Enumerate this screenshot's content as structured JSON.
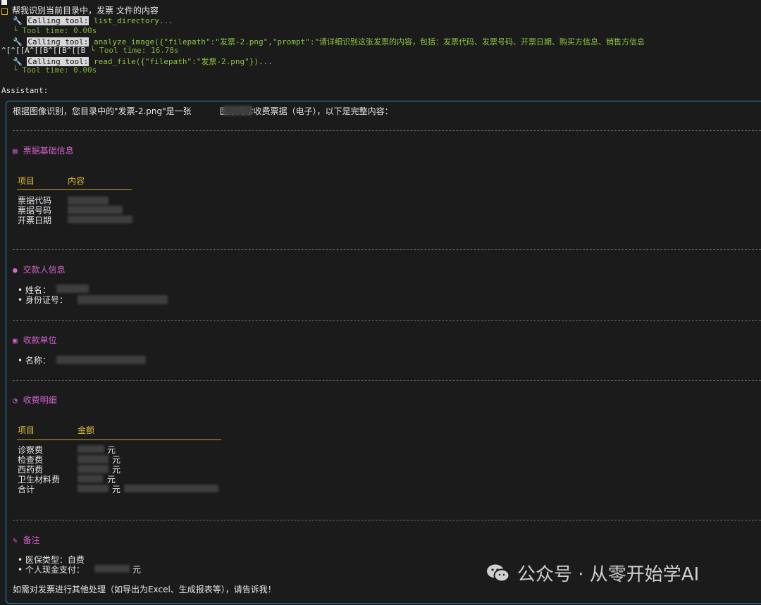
{
  "prompt": {
    "text": "帮我识别当前目录中，发票 文件的内容"
  },
  "tool_calls": [
    {
      "label": "Calling tool:",
      "call": "list_directory...",
      "time": "Tool time: 0.00s"
    },
    {
      "label": "Calling tool:",
      "call": "analyze_image({\"filepath\":\"发票-2.png\",\"prompt\":\"请详细识别这张发票的内容，包括：发票代码、发票号码、开票日期、购买方信息、销售方信息",
      "escape": "^[^[[A^[[B^[[B^[[B",
      "time": "Tool time: 16.78s"
    },
    {
      "label": "Calling tool:",
      "call": "read_file({\"filepath\":\"发票-2.png\"})...",
      "time": "Tool time: 0.00s"
    }
  ],
  "assistant": {
    "label": "Assistant:",
    "intro_prefix": "根据图像识别，您目录中的\"发票-2.png\"是一张",
    "intro_suffix": "医疗门诊收费票据（电子），以下是完整内容：",
    "sections": {
      "basic": {
        "title": "票据基础信息",
        "headers": [
          "项目",
          "内容"
        ],
        "rows": [
          "票据代码",
          "票据号码",
          "开票日期"
        ]
      },
      "payer": {
        "title": "交款人信息",
        "items": [
          "姓名：",
          "身份证号："
        ]
      },
      "payee": {
        "title": "收款单位",
        "items": [
          "名称："
        ]
      },
      "fees": {
        "title": "收费明细",
        "headers": [
          "项目",
          "金额"
        ],
        "rows": [
          "诊察费",
          "检查费",
          "西药费",
          "卫生材料费",
          "合计"
        ],
        "unit": "元"
      },
      "notes": {
        "title": "备注",
        "items": [
          "医保类型：自费",
          "个人现金支付："
        ],
        "unit": "元"
      }
    },
    "footer": "如需对发票进行其他处理（如导出为Excel、生成报表等），请告诉我！"
  },
  "watermark": {
    "text": "公众号 · 从零开始学AI"
  }
}
